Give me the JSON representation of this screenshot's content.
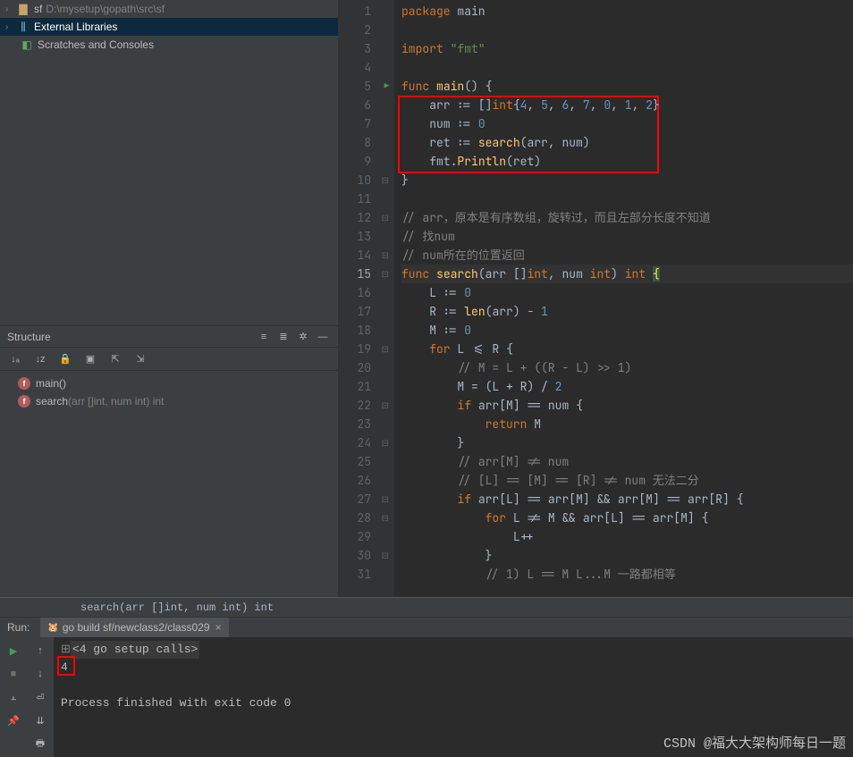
{
  "project": {
    "name": "sf",
    "path": "D:\\mysetup\\gopath\\src\\sf",
    "items": [
      {
        "label": "External Libraries"
      },
      {
        "label": "Scratches and Consoles"
      }
    ]
  },
  "structure": {
    "title": "Structure",
    "members": [
      {
        "name": "main()",
        "sig": ""
      },
      {
        "name": "search",
        "sig": "(arr []int, num int) int"
      }
    ]
  },
  "run": {
    "label": "Run:",
    "tab": "go build sf/newclass2/class029",
    "setup": "<4 go setup calls>",
    "output": "4",
    "exit": "Process finished with exit code 0"
  },
  "breadcrumb": "search(arr []int, num int) int",
  "watermark": "CSDN @福大大架构师每日一题",
  "code": [
    {
      "n": 1,
      "tokens": [
        [
          "kw",
          "package "
        ],
        [
          "id",
          "main"
        ]
      ]
    },
    {
      "n": 2,
      "tokens": []
    },
    {
      "n": 3,
      "tokens": [
        [
          "kw",
          "import "
        ],
        [
          "str",
          "\"fmt\""
        ]
      ]
    },
    {
      "n": 4,
      "tokens": []
    },
    {
      "n": 5,
      "run": true,
      "fold": "⊟",
      "tokens": [
        [
          "kw",
          "func "
        ],
        [
          "fn",
          "main"
        ],
        [
          "op",
          "() {"
        ]
      ]
    },
    {
      "n": 6,
      "tokens": [
        [
          "op",
          "    "
        ],
        [
          "id",
          "arr "
        ],
        [
          "op",
          ":= []"
        ],
        [
          "kw",
          "int"
        ],
        [
          "op",
          "{"
        ],
        [
          "num",
          "4"
        ],
        [
          "op",
          ", "
        ],
        [
          "num",
          "5"
        ],
        [
          "op",
          ", "
        ],
        [
          "num",
          "6"
        ],
        [
          "op",
          ", "
        ],
        [
          "num",
          "7"
        ],
        [
          "op",
          ", "
        ],
        [
          "num",
          "0"
        ],
        [
          "op",
          ", "
        ],
        [
          "num",
          "1"
        ],
        [
          "op",
          ", "
        ],
        [
          "num",
          "2"
        ],
        [
          "op",
          "}"
        ]
      ]
    },
    {
      "n": 7,
      "tokens": [
        [
          "op",
          "    "
        ],
        [
          "id",
          "num "
        ],
        [
          "op",
          ":= "
        ],
        [
          "num",
          "0"
        ]
      ]
    },
    {
      "n": 8,
      "tokens": [
        [
          "op",
          "    "
        ],
        [
          "id",
          "ret "
        ],
        [
          "op",
          ":= "
        ],
        [
          "fn",
          "search"
        ],
        [
          "op",
          "("
        ],
        [
          "id",
          "arr"
        ],
        [
          "op",
          ", "
        ],
        [
          "id",
          "num"
        ],
        [
          "op",
          ")"
        ]
      ]
    },
    {
      "n": 9,
      "tokens": [
        [
          "op",
          "    "
        ],
        [
          "id",
          "fmt"
        ],
        [
          "op",
          "."
        ],
        [
          "fn",
          "Println"
        ],
        [
          "op",
          "("
        ],
        [
          "id",
          "ret"
        ],
        [
          "op",
          ")"
        ]
      ]
    },
    {
      "n": 10,
      "fold": "⊟",
      "tokens": [
        [
          "op",
          "}"
        ]
      ]
    },
    {
      "n": 11,
      "tokens": []
    },
    {
      "n": 12,
      "fold": "⊟",
      "tokens": [
        [
          "cmt",
          "// arr，原本是有序数组，旋转过，而且左部分长度不知道"
        ]
      ]
    },
    {
      "n": 13,
      "tokens": [
        [
          "cmt",
          "// 找num"
        ]
      ]
    },
    {
      "n": 14,
      "fold": "⊟",
      "tokens": [
        [
          "cmt",
          "// num所在的位置返回"
        ]
      ]
    },
    {
      "n": 15,
      "current": true,
      "fold": "⊟",
      "tokens": [
        [
          "kw",
          "func "
        ],
        [
          "fn",
          "search"
        ],
        [
          "op",
          "("
        ],
        [
          "id",
          "arr "
        ],
        [
          "op",
          "[]"
        ],
        [
          "kw",
          "int"
        ],
        [
          "op",
          ", "
        ],
        [
          "id",
          "num "
        ],
        [
          "kw",
          "int"
        ],
        [
          "op",
          ") "
        ],
        [
          "kw",
          "int "
        ],
        [
          "brace-hl",
          "{"
        ]
      ]
    },
    {
      "n": 16,
      "tokens": [
        [
          "op",
          "    "
        ],
        [
          "id",
          "L "
        ],
        [
          "op",
          ":= "
        ],
        [
          "num",
          "0"
        ]
      ]
    },
    {
      "n": 17,
      "tokens": [
        [
          "op",
          "    "
        ],
        [
          "id",
          "R "
        ],
        [
          "op",
          ":= "
        ],
        [
          "fn",
          "len"
        ],
        [
          "op",
          "("
        ],
        [
          "id",
          "arr"
        ],
        [
          "op",
          ") - "
        ],
        [
          "num",
          "1"
        ]
      ]
    },
    {
      "n": 18,
      "tokens": [
        [
          "op",
          "    "
        ],
        [
          "id",
          "M "
        ],
        [
          "op",
          ":= "
        ],
        [
          "num",
          "0"
        ]
      ]
    },
    {
      "n": 19,
      "fold": "⊟",
      "tokens": [
        [
          "op",
          "    "
        ],
        [
          "kw",
          "for "
        ],
        [
          "id",
          "L "
        ],
        [
          "op",
          "<= "
        ],
        [
          "id",
          "R "
        ],
        [
          "op",
          "{"
        ]
      ]
    },
    {
      "n": 20,
      "tokens": [
        [
          "op",
          "        "
        ],
        [
          "cmt",
          "// M = L + ((R - L) >> 1)"
        ]
      ]
    },
    {
      "n": 21,
      "tokens": [
        [
          "op",
          "        "
        ],
        [
          "id",
          "M "
        ],
        [
          "op",
          "= ("
        ],
        [
          "id",
          "L "
        ],
        [
          "op",
          "+ "
        ],
        [
          "id",
          "R"
        ],
        [
          "op",
          ") / "
        ],
        [
          "num",
          "2"
        ]
      ]
    },
    {
      "n": 22,
      "fold": "⊟",
      "tokens": [
        [
          "op",
          "        "
        ],
        [
          "kw",
          "if "
        ],
        [
          "id",
          "arr"
        ],
        [
          "op",
          "["
        ],
        [
          "id",
          "M"
        ],
        [
          "op",
          "] == "
        ],
        [
          "id",
          "num "
        ],
        [
          "op",
          "{"
        ]
      ]
    },
    {
      "n": 23,
      "tokens": [
        [
          "op",
          "            "
        ],
        [
          "kw",
          "return "
        ],
        [
          "id",
          "M"
        ]
      ]
    },
    {
      "n": 24,
      "fold": "⊟",
      "tokens": [
        [
          "op",
          "        }"
        ]
      ]
    },
    {
      "n": 25,
      "tokens": [
        [
          "op",
          "        "
        ],
        [
          "cmt",
          "// arr[M] != num"
        ]
      ]
    },
    {
      "n": 26,
      "tokens": [
        [
          "op",
          "        "
        ],
        [
          "cmt",
          "// [L] == [M] == [R] != num 无法二分"
        ]
      ]
    },
    {
      "n": 27,
      "fold": "⊟",
      "tokens": [
        [
          "op",
          "        "
        ],
        [
          "kw",
          "if "
        ],
        [
          "id",
          "arr"
        ],
        [
          "op",
          "["
        ],
        [
          "id",
          "L"
        ],
        [
          "op",
          "] == "
        ],
        [
          "id",
          "arr"
        ],
        [
          "op",
          "["
        ],
        [
          "id",
          "M"
        ],
        [
          "op",
          "] && "
        ],
        [
          "id",
          "arr"
        ],
        [
          "op",
          "["
        ],
        [
          "id",
          "M"
        ],
        [
          "op",
          "] == "
        ],
        [
          "id",
          "arr"
        ],
        [
          "op",
          "["
        ],
        [
          "id",
          "R"
        ],
        [
          "op",
          "] {"
        ]
      ]
    },
    {
      "n": 28,
      "fold": "⊟",
      "tokens": [
        [
          "op",
          "            "
        ],
        [
          "kw",
          "for "
        ],
        [
          "id",
          "L "
        ],
        [
          "op",
          "!= "
        ],
        [
          "id",
          "M "
        ],
        [
          "op",
          "&& "
        ],
        [
          "id",
          "arr"
        ],
        [
          "op",
          "["
        ],
        [
          "id",
          "L"
        ],
        [
          "op",
          "] == "
        ],
        [
          "id",
          "arr"
        ],
        [
          "op",
          "["
        ],
        [
          "id",
          "M"
        ],
        [
          "op",
          "] {"
        ]
      ]
    },
    {
      "n": 29,
      "tokens": [
        [
          "op",
          "                "
        ],
        [
          "id",
          "L"
        ],
        [
          "op",
          "++"
        ]
      ]
    },
    {
      "n": 30,
      "fold": "⊟",
      "tokens": [
        [
          "op",
          "            }"
        ]
      ]
    },
    {
      "n": 31,
      "tokens": [
        [
          "op",
          "            "
        ],
        [
          "cmt",
          "// 1) L == M L...M 一路都相等"
        ]
      ]
    }
  ]
}
